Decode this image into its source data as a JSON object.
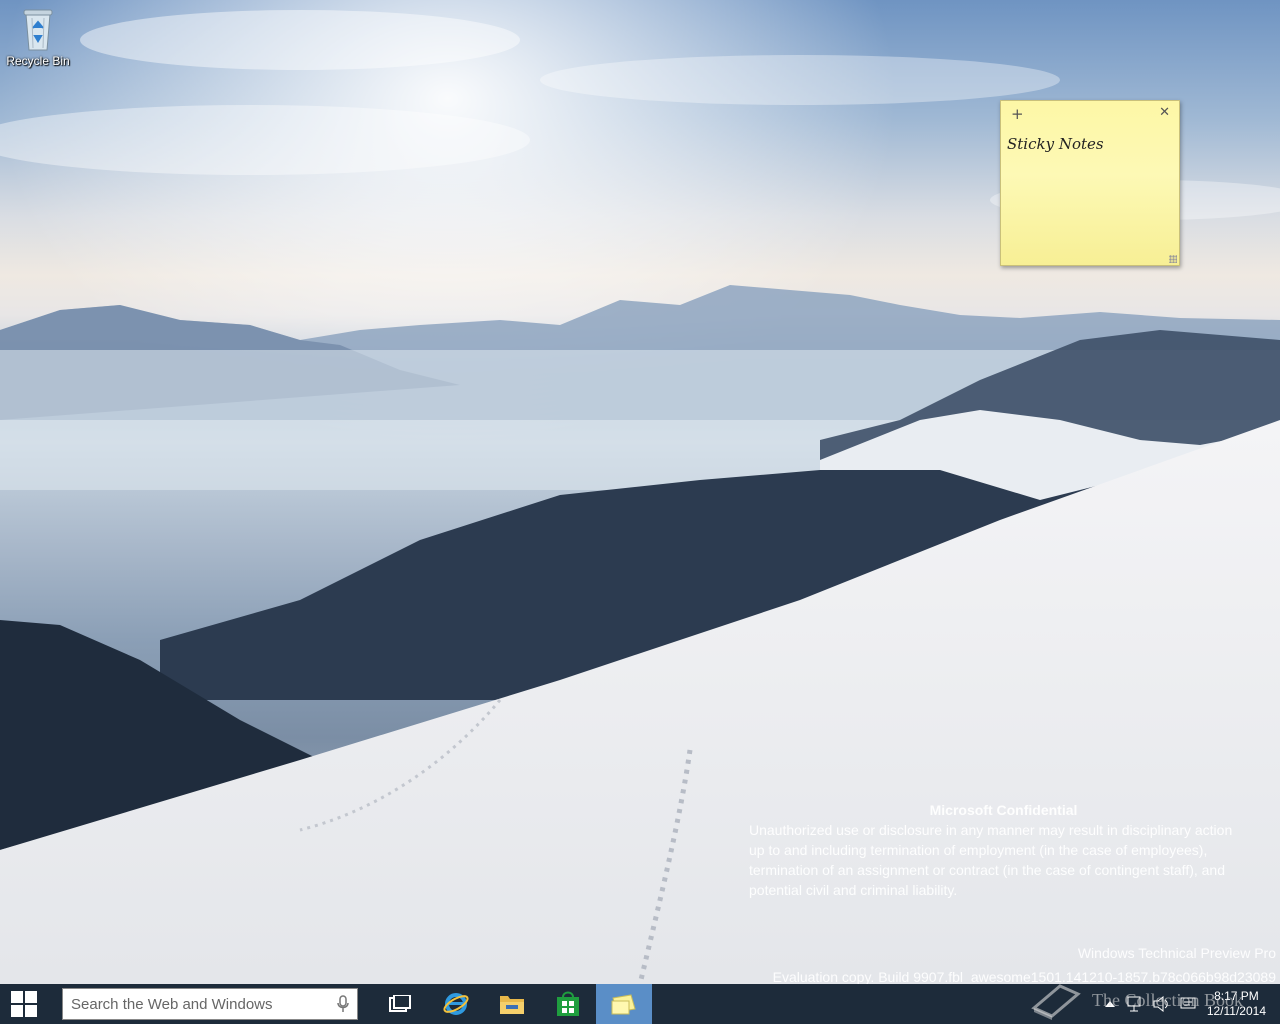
{
  "desktop": {
    "icons": [
      {
        "label": "Recycle Bin",
        "icon": "recycle-bin-icon"
      }
    ]
  },
  "sticky_note": {
    "text": "Sticky Notes",
    "add_glyph": "+",
    "close_glyph": "✕",
    "color": "#fdf7a6"
  },
  "watermark": {
    "heading": "Microsoft Confidential",
    "lines": [
      "Unauthorized use or disclosure in any manner may result in disciplinary action",
      "up to and including termination of employment (in the case of employees),",
      "termination of an assignment or contract (in the case of contingent staff), and",
      "potential civil and criminal liability."
    ],
    "edition": "Windows Technical Preview Pro",
    "build": "Evaluation copy. Build 9907.fbl_awesome1501.141210-1857.b78c066b98d23089"
  },
  "taskbar": {
    "search_placeholder": "Search the Web and Windows",
    "pinned": [
      {
        "name": "task-view",
        "icon": "task-view-icon"
      },
      {
        "name": "internet-explorer",
        "icon": "ie-icon"
      },
      {
        "name": "file-explorer",
        "icon": "folder-icon"
      },
      {
        "name": "store",
        "icon": "store-icon"
      },
      {
        "name": "sticky-notes",
        "icon": "sticky-notes-icon",
        "active": true
      }
    ],
    "clock_time": "8:17 PM",
    "clock_date": "12/11/2014",
    "brand_text": "The Collection Book",
    "accent": "#5a8ec7",
    "background": "#1d2b3a"
  }
}
